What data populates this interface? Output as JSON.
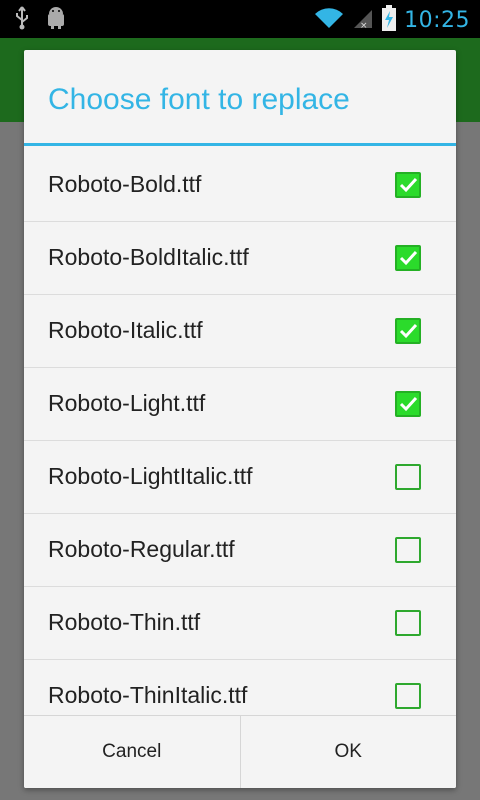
{
  "status_bar": {
    "time": "10:25",
    "icons": [
      "usb-icon",
      "android-debug-icon",
      "wifi-icon",
      "signal-icon",
      "battery-charging-icon"
    ]
  },
  "dialog": {
    "title": "Choose font to replace",
    "items": [
      {
        "label": "Roboto-Bold.ttf",
        "checked": true
      },
      {
        "label": "Roboto-BoldItalic.ttf",
        "checked": true
      },
      {
        "label": "Roboto-Italic.ttf",
        "checked": true
      },
      {
        "label": "Roboto-Light.ttf",
        "checked": true
      },
      {
        "label": "Roboto-LightItalic.ttf",
        "checked": false
      },
      {
        "label": "Roboto-Regular.ttf",
        "checked": false
      },
      {
        "label": "Roboto-Thin.ttf",
        "checked": false
      },
      {
        "label": "Roboto-ThinItalic.ttf",
        "checked": false
      }
    ],
    "cancel_label": "Cancel",
    "ok_label": "OK"
  },
  "colors": {
    "accent": "#33b5e5",
    "app_bar": "#1d6a1d",
    "checkbox_checked": "#2bdb2b",
    "checkbox_border": "#2ea82e"
  }
}
